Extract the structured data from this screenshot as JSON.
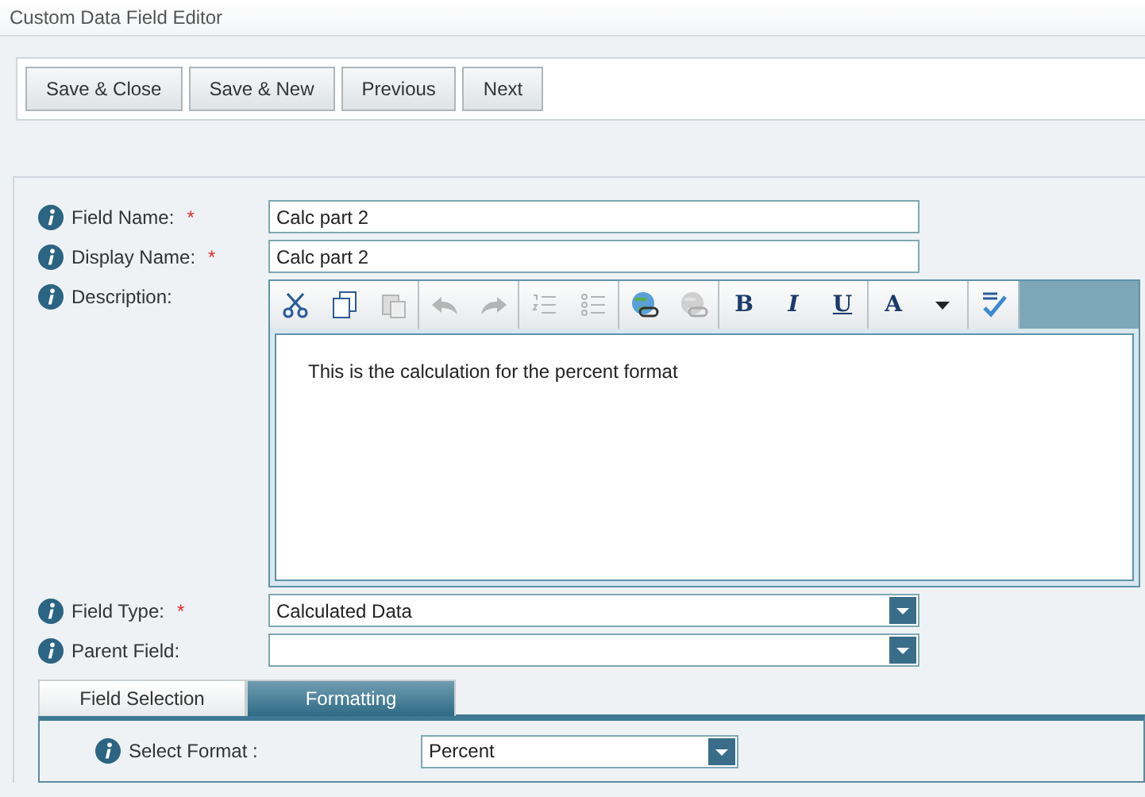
{
  "window": {
    "title": "Custom Data Field Editor"
  },
  "toolbar": [
    {
      "label": "Save & Close"
    },
    {
      "label": "Save & New"
    },
    {
      "label": "Previous"
    },
    {
      "label": "Next"
    }
  ],
  "fields": [
    {
      "label": "Field Name:",
      "required_mark": "*",
      "kind": "text",
      "value": "Calc part 2"
    },
    {
      "label": "Display Name:",
      "required_mark": "*",
      "kind": "text",
      "value": "Calc part 2"
    },
    {
      "label": "Description:",
      "kind": "editor",
      "value": "This is the calculation for the percent format"
    },
    {
      "label": "Field Type:",
      "required_mark": "*",
      "kind": "select",
      "value": "Calculated Data"
    },
    {
      "label": "Parent Field:",
      "kind": "select"
    }
  ],
  "editor_tools": [
    [
      {
        "disabled": false
      },
      {
        "disabled": false
      },
      {
        "disabled": true
      }
    ],
    [
      {
        "disabled": true
      },
      {
        "disabled": true
      }
    ],
    [
      {
        "disabled": true
      },
      {
        "disabled": true
      }
    ],
    [
      {
        "disabled": false
      },
      {
        "disabled": true
      }
    ],
    [
      {
        "label": "B",
        "disabled": false
      },
      {
        "label": "I",
        "disabled": false
      },
      {
        "label": "U",
        "disabled": false
      }
    ],
    [
      {
        "label": "A",
        "disabled": false
      },
      {
        "disabled": false
      }
    ],
    [
      {
        "disabled": false
      }
    ]
  ],
  "tabs": [
    {
      "label": "Field Selection",
      "selected": false
    },
    {
      "label": "Formatting",
      "selected": true
    }
  ],
  "format": {
    "label": "Select Format :",
    "value": "Percent"
  }
}
